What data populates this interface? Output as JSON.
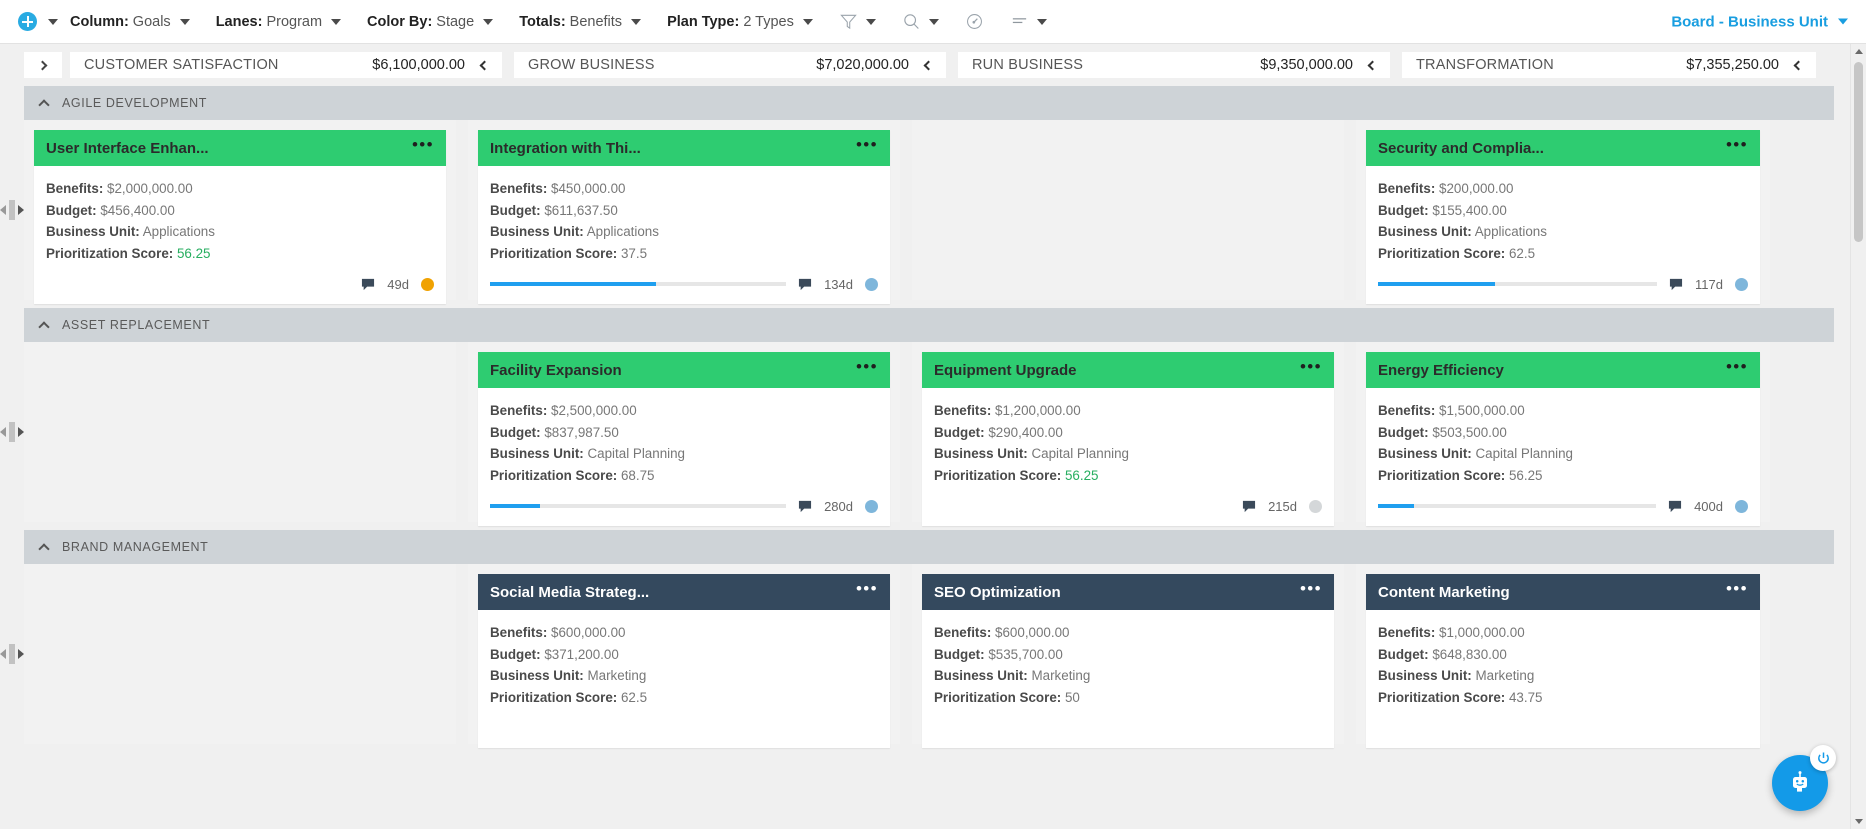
{
  "toolbar": {
    "add_icon": "plus-circle-icon",
    "controls": [
      {
        "label": "Column:",
        "value": "Goals"
      },
      {
        "label": "Lanes:",
        "value": "Program"
      },
      {
        "label": "Color By:",
        "value": "Stage"
      },
      {
        "label": "Totals:",
        "value": "Benefits"
      },
      {
        "label": "Plan Type:",
        "value": "2 Types"
      }
    ],
    "icons": [
      "filter-icon",
      "search-icon",
      "gauge-icon",
      "sort-icon"
    ],
    "board_title": "Board - Business Unit"
  },
  "board": {
    "expander_icon": "chevron-right-icon",
    "columns": [
      {
        "name": "CUSTOMER SATISFACTION",
        "total": "$6,100,000.00"
      },
      {
        "name": "GROW BUSINESS",
        "total": "$7,020,000.00"
      },
      {
        "name": "RUN BUSINESS",
        "total": "$9,350,000.00"
      },
      {
        "name": "TRANSFORMATION",
        "total": "$7,355,250.00"
      }
    ],
    "lanes": [
      {
        "name": "AGILE DEVELOPMENT",
        "cards": [
          {
            "title": "User Interface Enhan...",
            "header_color": "green",
            "benefits": "$2,000,000.00",
            "budget": "$456,400.00",
            "business_unit": "Applications",
            "score": "56.25",
            "score_style": "green",
            "progress": 0,
            "show_progress": false,
            "days": "49d",
            "dot_color": "#f0a202"
          },
          {
            "title": "Integration with Thi...",
            "header_color": "green",
            "benefits": "$450,000.00",
            "budget": "$611,637.50",
            "business_unit": "Applications",
            "score": "37.5",
            "score_style": "plain",
            "progress": 56,
            "show_progress": true,
            "days": "134d",
            "dot_color": "#7eb6db"
          },
          null,
          {
            "title": "Security and Complia...",
            "header_color": "green",
            "benefits": "$200,000.00",
            "budget": "$155,400.00",
            "business_unit": "Applications",
            "score": "62.5",
            "score_style": "plain",
            "progress": 42,
            "show_progress": true,
            "days": "117d",
            "dot_color": "#7eb6db"
          }
        ]
      },
      {
        "name": "ASSET REPLACEMENT",
        "cards": [
          null,
          {
            "title": "Facility Expansion",
            "header_color": "green",
            "benefits": "$2,500,000.00",
            "budget": "$837,987.50",
            "business_unit": "Capital Planning",
            "score": "68.75",
            "score_style": "plain",
            "progress": 17,
            "show_progress": true,
            "days": "280d",
            "dot_color": "#7eb6db"
          },
          {
            "title": "Equipment Upgrade",
            "header_color": "green",
            "benefits": "$1,200,000.00",
            "budget": "$290,400.00",
            "business_unit": "Capital Planning",
            "score": "56.25",
            "score_style": "green",
            "progress": 0,
            "show_progress": false,
            "days": "215d",
            "dot_color": "#d4d7d9"
          },
          {
            "title": "Energy Efficiency",
            "header_color": "green",
            "benefits": "$1,500,000.00",
            "budget": "$503,500.00",
            "business_unit": "Capital Planning",
            "score": "56.25",
            "score_style": "plain",
            "progress": 13,
            "show_progress": true,
            "days": "400d",
            "dot_color": "#7eb6db"
          }
        ]
      },
      {
        "name": "BRAND MANAGEMENT",
        "cards": [
          null,
          {
            "title": "Social Media Strateg...",
            "header_color": "dark",
            "benefits": "$600,000.00",
            "budget": "$371,200.00",
            "business_unit": "Marketing",
            "score": "62.5",
            "score_style": "plain",
            "progress": 0,
            "show_progress": false,
            "days": "",
            "dot_color": ""
          },
          {
            "title": "SEO Optimization",
            "header_color": "dark",
            "benefits": "$600,000.00",
            "budget": "$535,700.00",
            "business_unit": "Marketing",
            "score": "50",
            "score_style": "plain",
            "progress": 0,
            "show_progress": false,
            "days": "",
            "dot_color": ""
          },
          {
            "title": "Content Marketing",
            "header_color": "dark",
            "benefits": "$1,000,000.00",
            "budget": "$648,830.00",
            "business_unit": "Marketing",
            "score": "43.75",
            "score_style": "plain",
            "progress": 0,
            "show_progress": false,
            "days": "",
            "dot_color": ""
          }
        ]
      }
    ],
    "field_labels": {
      "benefits": "Benefits:",
      "budget": "Budget:",
      "business_unit": "Business Unit:",
      "score": "Prioritization Score:"
    },
    "card_menu_icon": "ellipsis-icon",
    "comment_icon": "comment-bubble-icon"
  },
  "fab": {
    "chat_icon": "chatbot-icon",
    "power_icon": "power-icon"
  },
  "colors": {
    "accent": "#199ee0",
    "card_green": "#2ecc71",
    "card_dark": "#34495e",
    "progress": "#1f9fef",
    "lane_header": "#ced3d7"
  }
}
